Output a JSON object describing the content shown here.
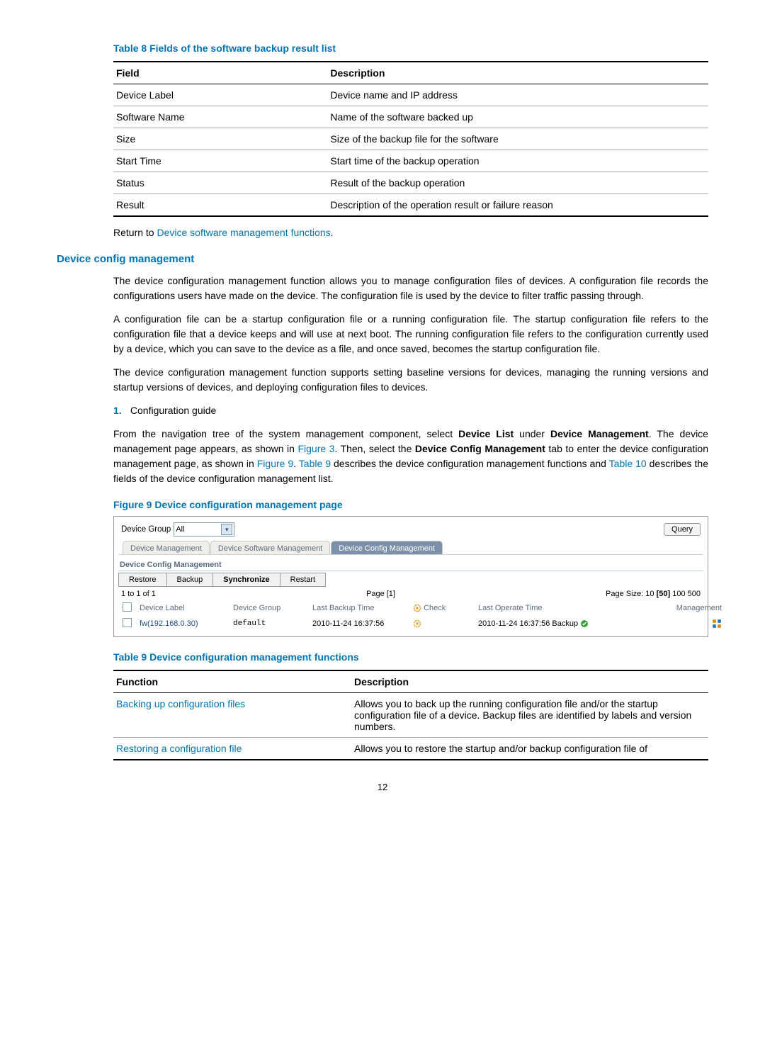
{
  "table8": {
    "title": "Table 8 Fields of the software backup result list",
    "head_field": "Field",
    "head_desc": "Description",
    "rows": [
      {
        "f": "Device Label",
        "d": "Device name and IP address"
      },
      {
        "f": "Software Name",
        "d": "Name of the software backed up"
      },
      {
        "f": "Size",
        "d": "Size of the backup file for the software"
      },
      {
        "f": "Start Time",
        "d": "Start time of the backup operation"
      },
      {
        "f": "Status",
        "d": "Result of the backup operation"
      },
      {
        "f": "Result",
        "d": "Description of the operation result or failure reason"
      }
    ]
  },
  "return_prefix": "Return to ",
  "return_link": "Device software management functions",
  "return_suffix": ".",
  "section_heading": "Device config management",
  "para1": "The device configuration management function allows you to manage configuration files of devices. A configuration file records the configurations users have made on the device. The configuration file is used by the device to filter traffic passing through.",
  "para2": "A configuration file can be a startup configuration file or a running configuration file. The startup configuration file refers to the configuration file that a device keeps and will use at next boot. The running configuration file refers to the configuration currently used by a device, which you can save to the device as a file, and once saved, becomes the startup configuration file.",
  "para3": "The device configuration management function supports setting baseline versions for devices, managing the running versions and startup versions of devices, and deploying configuration files to devices.",
  "list1_num": "1.",
  "list1_text": "Configuration guide",
  "para4_parts": {
    "p1": "From the navigation tree of the system management component, select ",
    "b1": "Device List",
    "p2": " under ",
    "b2": "Device Management",
    "p3": ". The device management page appears, as shown in ",
    "l1": "Figure 3",
    "p4": ". Then, select the ",
    "b3": "Device Config Management",
    "p5": " tab to enter the device configuration management page, as shown in ",
    "l2": "Figure 9",
    "p6": ". ",
    "l3": "Table 9",
    "p7": " describes the device configuration management functions and ",
    "l4": "Table 10",
    "p8": " describes the fields of the device configuration management list."
  },
  "figure9_caption": "Figure 9 Device configuration management page",
  "ss": {
    "device_group_label": "Device Group",
    "device_group_value": "All",
    "query_btn": "Query",
    "tab1": "Device Management",
    "tab2": "Device Software Management",
    "tab3": "Device Config Management",
    "subheader": "Device Config Management",
    "toolbar": [
      "Restore",
      "Backup",
      "Synchronize",
      "Restart"
    ],
    "pager_left": "1 to 1 of 1",
    "pager_mid": "Page [1]",
    "pager_right_prefix": "Page Size: 10 ",
    "pager_right_cur": "[50]",
    "pager_right_suffix": " 100 500",
    "cols": {
      "device_label": "Device Label",
      "device_group": "Device Group",
      "last_backup": "Last Backup Time",
      "check": "Check",
      "last_operate": "Last Operate Time",
      "management": "Management"
    },
    "row": {
      "device_label": "fw(192.168.0.30)",
      "device_group": "default",
      "last_backup": "2010-11-24 16:37:56",
      "last_operate": "2010-11-24 16:37:56 Backup"
    }
  },
  "table9": {
    "title": "Table 9 Device configuration management functions",
    "head_func": "Function",
    "head_desc": "Description",
    "rows": [
      {
        "f": "Backing up configuration files",
        "d": "Allows you to back up the running configuration file and/or the startup configuration file of a device. Backup files are identified by labels and version numbers."
      },
      {
        "f": "Restoring a configuration file",
        "d": "Allows you to restore the startup and/or backup configuration file of"
      }
    ]
  },
  "page_number": "12"
}
